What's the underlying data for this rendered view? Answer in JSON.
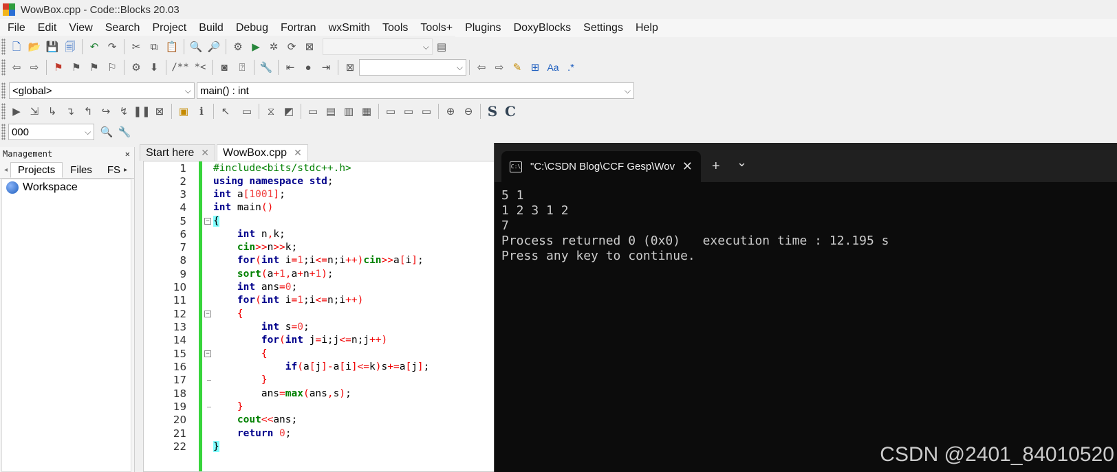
{
  "window": {
    "title": "WowBox.cpp - Code::Blocks 20.03"
  },
  "menu": [
    "File",
    "Edit",
    "View",
    "Search",
    "Project",
    "Build",
    "Debug",
    "Fortran",
    "wxSmith",
    "Tools",
    "Tools+",
    "Plugins",
    "DoxyBlocks",
    "Settings",
    "Help"
  ],
  "toolbar3": {
    "scope": "<global>",
    "function": "main() : int"
  },
  "toolbar5": {
    "combo": "000"
  },
  "toolbar2": {
    "doc_comment": "/**",
    "doc_inline": "*<",
    "regex": ".*",
    "aa": "Aa"
  },
  "toolbar4": {
    "s_label": "S",
    "c_label": "C"
  },
  "management": {
    "title": "Management",
    "tabs": [
      "Projects",
      "Files",
      "FS"
    ],
    "tree": {
      "workspace": "Workspace"
    }
  },
  "editor": {
    "tabs": [
      "Start here",
      "WowBox.cpp"
    ],
    "line_numbers": [
      "1",
      "2",
      "3",
      "4",
      "5",
      "6",
      "7",
      "8",
      "9",
      "10",
      "11",
      "12",
      "13",
      "14",
      "15",
      "16",
      "17",
      "18",
      "19",
      "20",
      "21",
      "22"
    ]
  },
  "console": {
    "tab_title": "\"C:\\CSDN Blog\\CCF Gesp\\Wov",
    "new_tab": "+",
    "dropdown": "⌄",
    "lines": [
      "5 1",
      "1 2 3 1 2",
      "7",
      "Process returned 0 (0x0)   execution time : 12.195 s",
      "Press any key to continue."
    ]
  },
  "watermark": "CSDN @2401_84010520",
  "colors": {
    "keyword": "#00008b",
    "preprocessor": "#008000",
    "number": "#f04040",
    "change_bar": "#37d43b",
    "console_bg": "#0c0c0c"
  }
}
